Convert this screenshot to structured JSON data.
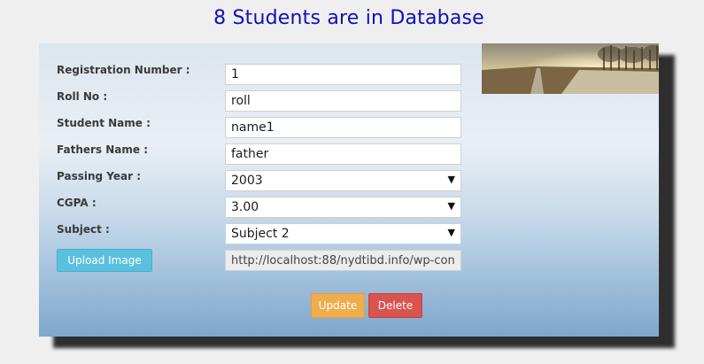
{
  "page": {
    "title": "8 Students are in Database"
  },
  "form": {
    "fields": [
      {
        "label": "Registration Number :",
        "value": "1"
      },
      {
        "label": "Roll No :",
        "value": "roll"
      },
      {
        "label": "Student Name :",
        "value": "name1"
      },
      {
        "label": "Fathers Name :",
        "value": "father"
      },
      {
        "label": "Passing Year :",
        "value": "2003"
      },
      {
        "label": "CGPA :",
        "value": "3.00"
      },
      {
        "label": "Subject :",
        "value": "Subject 2"
      }
    ],
    "image_url": "http://localhost:88/nydtibd.info/wp-con",
    "upload_label": "Upload Image",
    "update_label": "Update",
    "delete_label": "Delete",
    "dropdown_icon": "caret-down-icon"
  },
  "colors": {
    "title": "#1010b8",
    "upload": "#5bc0de",
    "update": "#f0ad4e",
    "delete": "#d9534f"
  }
}
